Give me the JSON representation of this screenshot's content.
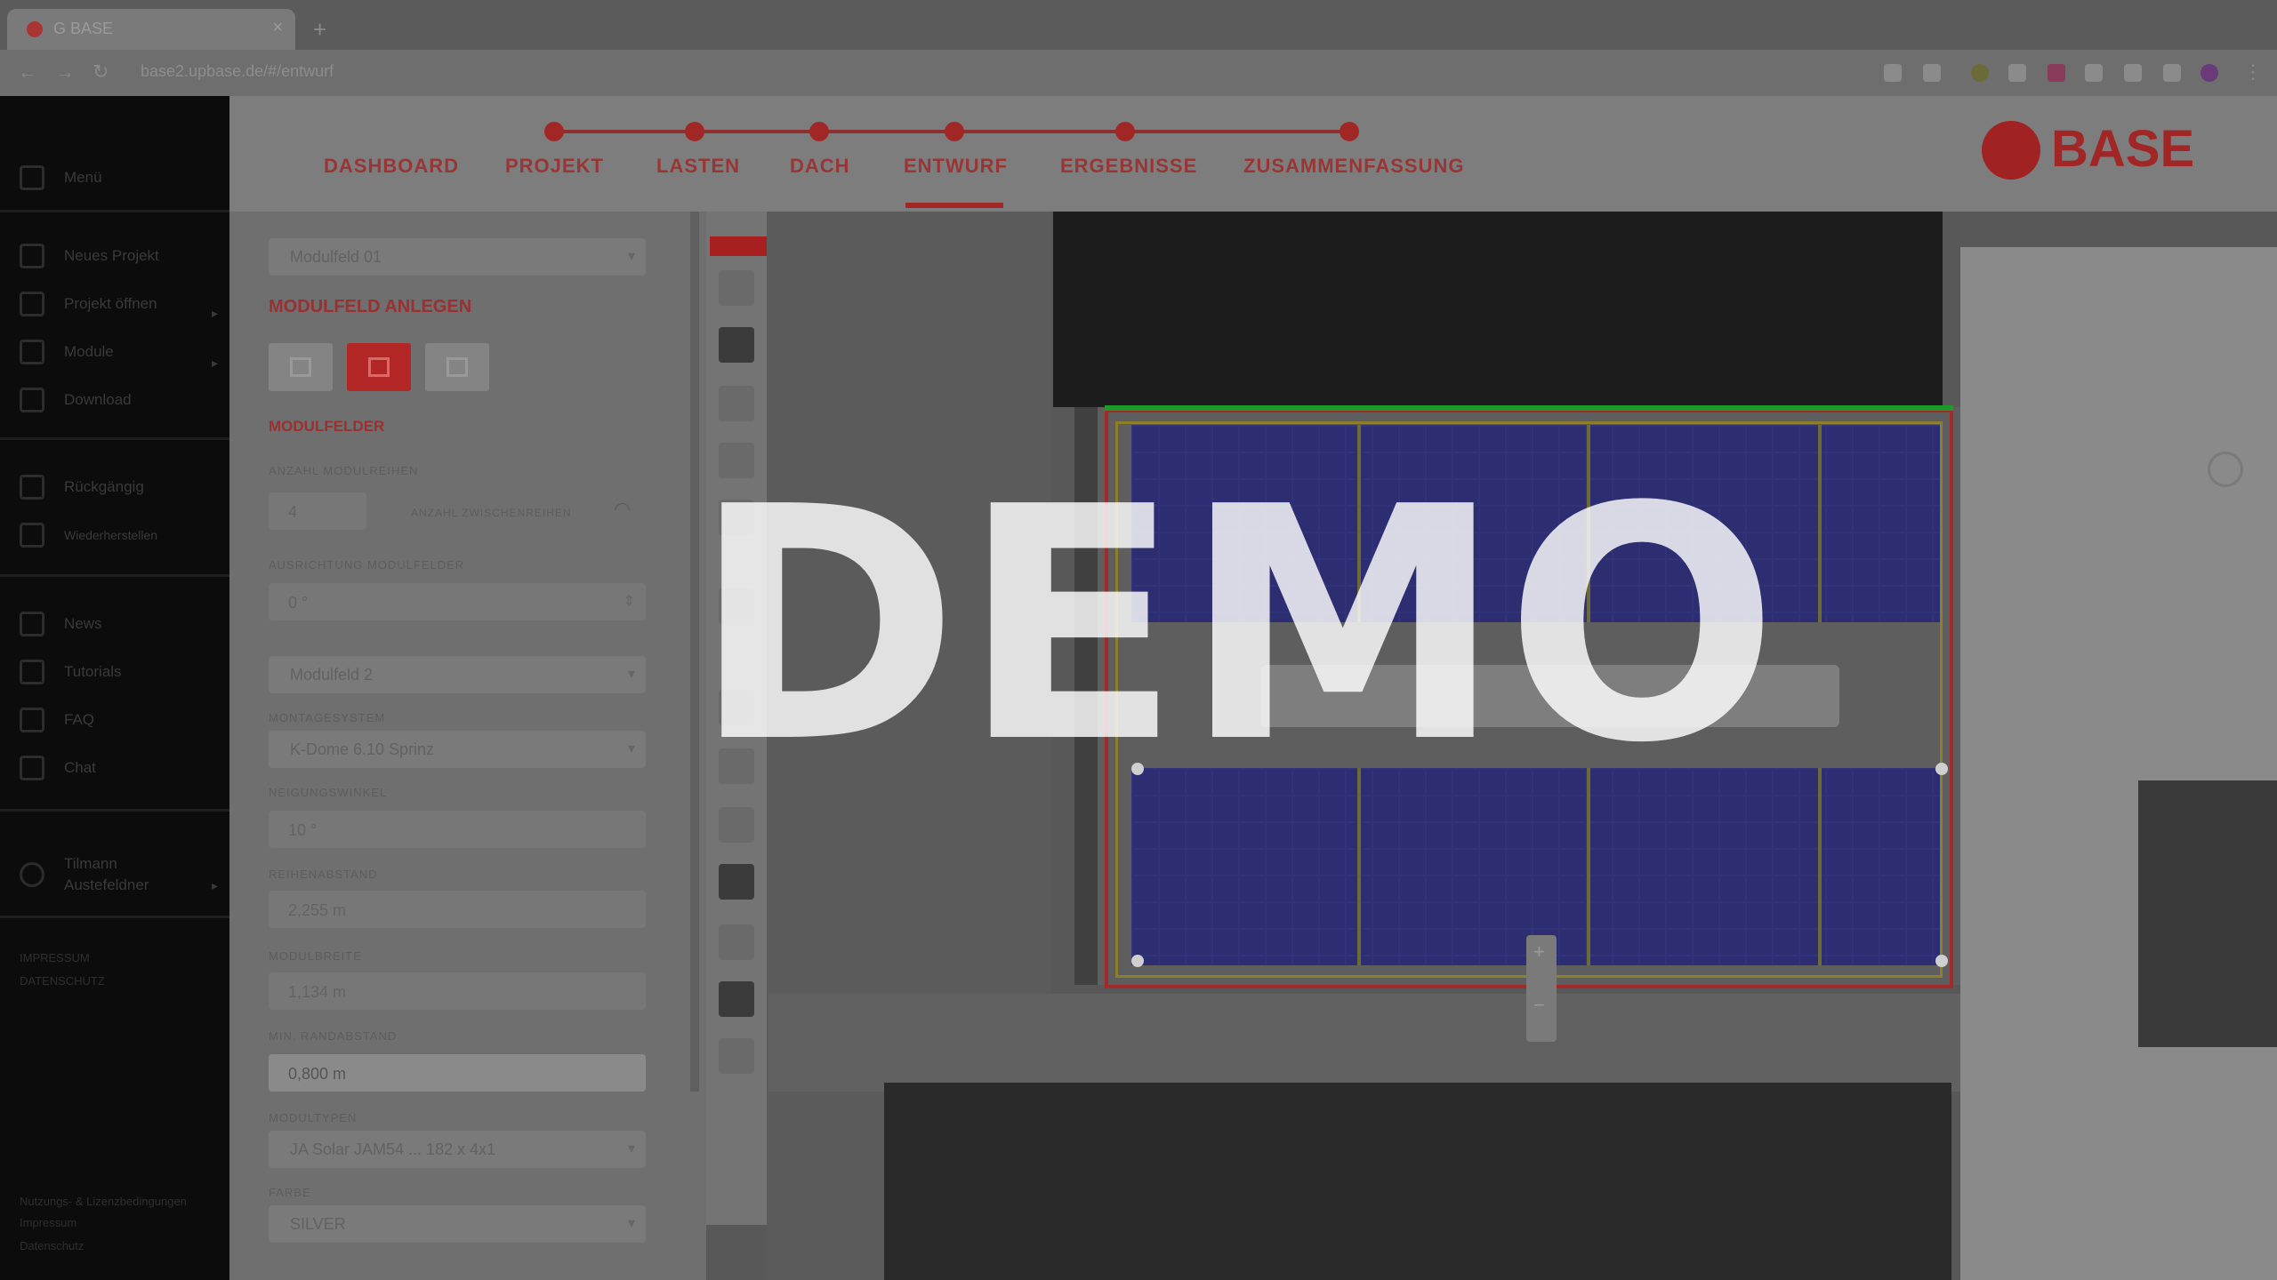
{
  "browser": {
    "tab_title": "G BASE",
    "url": "base2.upbase.de/#/entwurf",
    "new_tab_symbol": "+"
  },
  "sidebar": {
    "items": [
      {
        "label": "Menü",
        "icon": "menu-icon"
      },
      {
        "label": "Neues Projekt",
        "icon": "new-project-icon"
      },
      {
        "label": "Projekt öffnen",
        "icon": "folder-open-icon"
      },
      {
        "label": "Module",
        "icon": "module-icon"
      },
      {
        "label": "Download",
        "icon": "download-icon"
      },
      {
        "label": "Rückgängig",
        "icon": "undo-icon"
      },
      {
        "label": "Wiederherstellen",
        "icon": "redo-icon"
      },
      {
        "label": "News",
        "icon": "news-icon"
      },
      {
        "label": "Tutorials",
        "icon": "tutorials-icon"
      },
      {
        "label": "FAQ",
        "icon": "faq-icon"
      },
      {
        "label": "Chat",
        "icon": "chat-icon"
      },
      {
        "label": "Tilmann Austefeldner",
        "icon": "user-icon"
      }
    ],
    "footer_lines": [
      "IMPRESSUM",
      "DATENSCHUTZ"
    ],
    "legal_lines": [
      "Nutzungs- & Lizenzbedingungen",
      "Impressum",
      "Datenschutz"
    ]
  },
  "steps": [
    {
      "label": "DASHBOARD"
    },
    {
      "label": "PROJEKT"
    },
    {
      "label": "LASTEN"
    },
    {
      "label": "DACH"
    },
    {
      "label": "ENTWURF"
    },
    {
      "label": "ERGEBNISSE"
    },
    {
      "label": "ZUSAMMENFASSUNG"
    }
  ],
  "brand": {
    "logo_text": "BASE",
    "accent": "#a12727"
  },
  "panel": {
    "top_select": "Modulfeld 01",
    "section_title": "MODULFELD ANLEGEN",
    "subsection_title": "MODULFELDER",
    "fields": [
      {
        "label": "ANZAHL MODULREIHEN",
        "value": "4",
        "extra": "ANZAHL ZWISCHENREIHEN"
      },
      {
        "label": "AUSRICHTUNG MODULFELDER",
        "value": "0 °"
      },
      {
        "label": "",
        "value": "Modulfeld 2"
      },
      {
        "label": "MONTAGESYSTEM",
        "value": "K-Dome 6.10 Sprinz"
      },
      {
        "label": "NEIGUNGSWINKEL",
        "value": "10 °"
      },
      {
        "label": "REIHENABSTAND",
        "value": "2,255 m"
      },
      {
        "label": "MODULBREITE",
        "value": "1,134 m"
      },
      {
        "label": "MIN. RANDABSTAND",
        "value": "0,800 m"
      },
      {
        "label": "MODULTYPEN",
        "value": "JA Solar JAM54 ...  182 x 4x1"
      },
      {
        "label": "FARBE",
        "value": "SILVER"
      }
    ]
  },
  "map": {
    "zoom_in": "+",
    "zoom_out": "−"
  },
  "watermark": "DEMO"
}
